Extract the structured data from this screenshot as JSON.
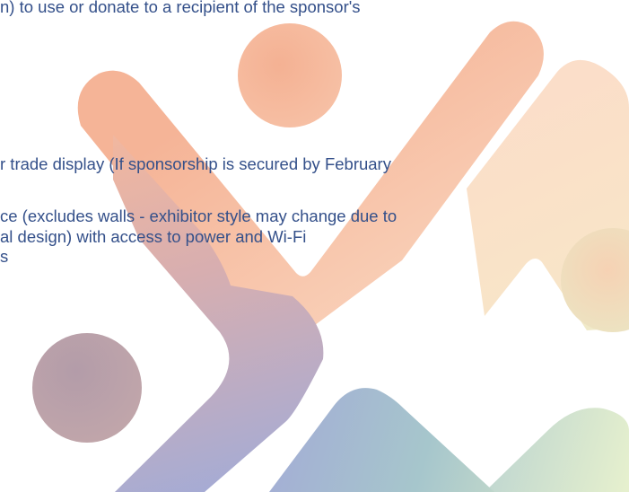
{
  "document": {
    "lines": [
      "n) to use or donate to a recipient of the sponsor's",
      "r trade display (If sponsorship is secured by February",
      "ce (excludes walls - exhibitor style may change due to",
      "al design) with access to power and Wi-Fi",
      "s"
    ]
  },
  "colors": {
    "text": "#34508a",
    "peach": "#f6b99c",
    "light_peach": "#fbdcc6",
    "mauve": "#b7a4b3",
    "periwinkle": "#a3abd6",
    "teal": "#a6c6cc",
    "light_green": "#e4efc8"
  }
}
